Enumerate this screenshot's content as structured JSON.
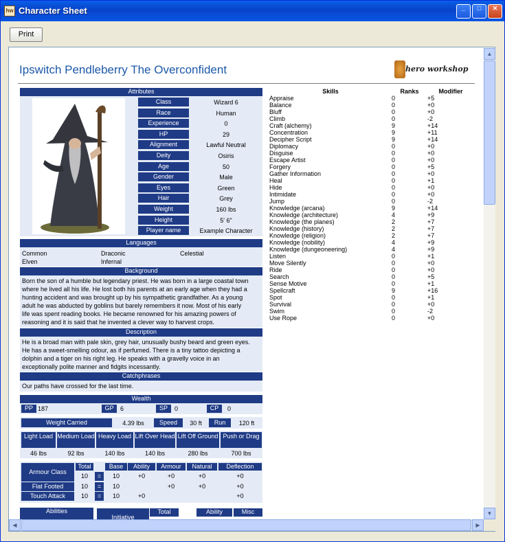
{
  "window": {
    "title": "Character Sheet",
    "icon_text": "hw",
    "min": "_",
    "max": "□",
    "close": "✕"
  },
  "toolbar": {
    "print_label": "Print"
  },
  "character": {
    "name": "Ipswitch Pendleberry The Overconfident"
  },
  "logo": {
    "text": "hero workshop"
  },
  "attributes": {
    "header": "Attributes",
    "rows": [
      {
        "label": "Class",
        "value": "Wizard 6"
      },
      {
        "label": "Race",
        "value": "Human"
      },
      {
        "label": "Experience",
        "value": "0"
      },
      {
        "label": "HP",
        "value": "29"
      },
      {
        "label": "Alignment",
        "value": "Lawful Neutral"
      },
      {
        "label": "Deity",
        "value": "Osiris"
      },
      {
        "label": "Age",
        "value": "50"
      },
      {
        "label": "Gender",
        "value": "Male"
      },
      {
        "label": "Eyes",
        "value": "Green"
      },
      {
        "label": "Hair",
        "value": "Grey"
      },
      {
        "label": "Weight",
        "value": "160 lbs"
      },
      {
        "label": "Height",
        "value": "5' 6\""
      },
      {
        "label": "Player name",
        "value": "Example Character"
      }
    ]
  },
  "languages": {
    "header": "Languages",
    "items": [
      "Common",
      "Draconic",
      "Celestial",
      "Elven",
      "Infernal"
    ]
  },
  "background": {
    "header": "Background",
    "lines": [
      "Born the son of a humble but legendary priest. He was born in a large coastal town",
      "where he lived all his life. He lost both his parents at an early age when they had a",
      "hunting accident and was brought up by his sympathetic grandfather. As a young",
      "adult he was abducted by goblins but barely remembers it now. Most of his early",
      "life was spent reading books. He became renowned for his amazing powers of",
      "reasoning and it is said that he invented a clever way to harvest crops."
    ]
  },
  "description": {
    "header": "Description",
    "lines": [
      "He is a broad man with pale skin, grey hair, unusually bushy beard and green eyes.",
      "He has a sweet-smelling odour, as if perfumed. There is a tiny tattoo depicting a",
      "dolphin and a tiger on his right leg. He speaks with a gravelly voice in an",
      "exceptionally polite manner and fidgits incessantly."
    ]
  },
  "catchphrases": {
    "header": "Catchphrases",
    "text": "Our paths have crossed for the last time."
  },
  "wealth": {
    "header": "Wealth",
    "pp_label": "PP",
    "pp": "187",
    "gp_label": "GP",
    "gp": "6",
    "sp_label": "SP",
    "sp": "0",
    "cp_label": "CP",
    "cp": "0"
  },
  "carry": {
    "weight_label": "Weight Carried",
    "weight": "4.39 lbs",
    "speed_label": "Speed",
    "speed": "30 ft",
    "run_label": "Run",
    "run": "120 ft"
  },
  "loads": {
    "headers": [
      "Light Load",
      "Medium Load",
      "Heavy Load",
      "Lift Over Head",
      "Lift Off Ground",
      "Push or Drag"
    ],
    "values": [
      "46 lbs",
      "92 lbs",
      "140 lbs",
      "140 lbs",
      "280 lbs",
      "700 lbs"
    ]
  },
  "armour": {
    "headers": [
      "Total",
      "Base",
      "Ability",
      "Armour",
      "Natural",
      "Deflection"
    ],
    "eq": "=",
    "rows": [
      {
        "label": "Armour Class",
        "total": "10",
        "base": "10",
        "ability": "+0",
        "armour": "+0",
        "natural": "+0",
        "deflection": "+0"
      },
      {
        "label": "Flat Footed",
        "total": "10",
        "base": "10",
        "ability": "",
        "armour": "+0",
        "natural": "+0",
        "deflection": "+0"
      },
      {
        "label": "Touch Attack",
        "total": "10",
        "base": "10",
        "ability": "+0",
        "armour": "",
        "natural": "",
        "deflection": "+0"
      }
    ]
  },
  "bottom": {
    "abilities_label": "Abilities",
    "initiative_label": "Initiative",
    "total_label": "Total",
    "ability_label": "Ability",
    "misc_label": "Misc"
  },
  "skills": {
    "headers": [
      "Skills",
      "Ranks",
      "Modifier"
    ],
    "rows": [
      [
        "Appraise",
        "0",
        "+5"
      ],
      [
        "Balance",
        "0",
        "+0"
      ],
      [
        "Bluff",
        "0",
        "+0"
      ],
      [
        "Climb",
        "0",
        "-2"
      ],
      [
        "Craft (alchemy)",
        "9",
        "+14"
      ],
      [
        "Concentration",
        "9",
        "+11"
      ],
      [
        "Decipher Script",
        "9",
        "+14"
      ],
      [
        "Diplomacy",
        "0",
        "+0"
      ],
      [
        "Disguise",
        "0",
        "+0"
      ],
      [
        "Escape Artist",
        "0",
        "+0"
      ],
      [
        "Forgery",
        "0",
        "+5"
      ],
      [
        "Gather Information",
        "0",
        "+0"
      ],
      [
        "Heal",
        "0",
        "+1"
      ],
      [
        "Hide",
        "0",
        "+0"
      ],
      [
        "Intimidate",
        "0",
        "+0"
      ],
      [
        "Jump",
        "0",
        "-2"
      ],
      [
        "Knowledge (arcana)",
        "9",
        "+14"
      ],
      [
        "Knowledge (architecture)",
        "4",
        "+9"
      ],
      [
        "Knowledge (the planes)",
        "2",
        "+7"
      ],
      [
        "Knowledge (history)",
        "2",
        "+7"
      ],
      [
        "Knowledge (religion)",
        "2",
        "+7"
      ],
      [
        "Knowledge (nobility)",
        "4",
        "+9"
      ],
      [
        "Knowledge (dungeoneering)",
        "4",
        "+9"
      ],
      [
        "Listen",
        "0",
        "+1"
      ],
      [
        "Move Silently",
        "0",
        "+0"
      ],
      [
        "Ride",
        "0",
        "+0"
      ],
      [
        "Search",
        "0",
        "+5"
      ],
      [
        "Sense Motive",
        "0",
        "+1"
      ],
      [
        "Spellcraft",
        "9",
        "+16"
      ],
      [
        "Spot",
        "0",
        "+1"
      ],
      [
        "Survival",
        "0",
        "+0"
      ],
      [
        "Swim",
        "0",
        "-2"
      ],
      [
        "Use Rope",
        "0",
        "+0"
      ],
      [
        "",
        "",
        ""
      ],
      [
        "",
        "",
        ""
      ],
      [
        "",
        "",
        ""
      ],
      [
        "",
        "",
        ""
      ],
      [
        "",
        "",
        ""
      ],
      [
        "",
        "",
        ""
      ],
      [
        "",
        "",
        ""
      ],
      [
        "",
        "",
        ""
      ]
    ]
  },
  "scroll": {
    "up": "▲",
    "down": "▼",
    "left": "◀",
    "right": "▶"
  }
}
